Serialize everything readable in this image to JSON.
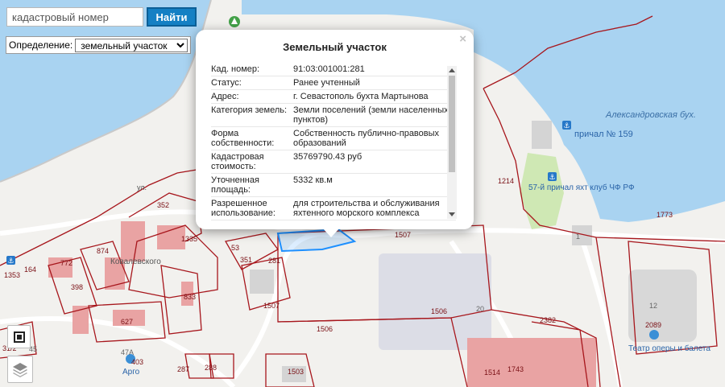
{
  "search": {
    "placeholder": "кадастровый номер",
    "button": "Найти"
  },
  "definition": {
    "label": "Определение:",
    "selected": "земельный участок"
  },
  "map": {
    "labels": {
      "bay": "Александровская бух.",
      "pier159": "причал № 159",
      "pier57": "57-й причал яхт клуб ЧФ РФ",
      "theatre": "Театр оперы и балета",
      "argo": "Арго",
      "kovalevsky": "Ковалевского",
      "vul": "ул.",
      "p352": "352",
      "p1335": "1335",
      "p874": "874",
      "p772": "772",
      "p398": "398",
      "p627": "627",
      "p833": "833",
      "p53": "53",
      "p351": "351",
      "p281": "281",
      "p1507a": "1507",
      "p1507b": "1507",
      "p1506a": "1506",
      "p1506b": "1506",
      "p20": "20",
      "p1214": "1214",
      "p1773": "1773",
      "p12": "12",
      "p2089": "2089",
      "p2382": "2382",
      "p1503": "1503",
      "p1514": "1514",
      "p1743": "1743",
      "p403": "403",
      "p47a": "47А",
      "p287": "287",
      "p288": "288",
      "p45": "45",
      "p3172": "31/2",
      "p1353": "1353",
      "p164": "164",
      "p1": "1"
    }
  },
  "popup": {
    "title": "Земельный участок",
    "close": "×",
    "rows": [
      {
        "k": "Кад. номер:",
        "v": "91:03:001001:281"
      },
      {
        "k": "Статус:",
        "v": "Ранее учтенный"
      },
      {
        "k": "Адрес:",
        "v": "г. Севастополь бухта Мартынова"
      },
      {
        "k": "Категория земель:",
        "v": "Земли поселений (земли населенных пунктов)"
      },
      {
        "k": "Форма собственности:",
        "v": "Собственность публично-правовых образований"
      },
      {
        "k": "Кадастровая стоимость:",
        "v": "35769790.43 руб"
      },
      {
        "k": "Уточненная площадь:",
        "v": "5332 кв.м"
      },
      {
        "k": "Разрешенное использование:",
        "v": "для строительства и обслуживания яхтенного морского комплекса"
      }
    ]
  }
}
